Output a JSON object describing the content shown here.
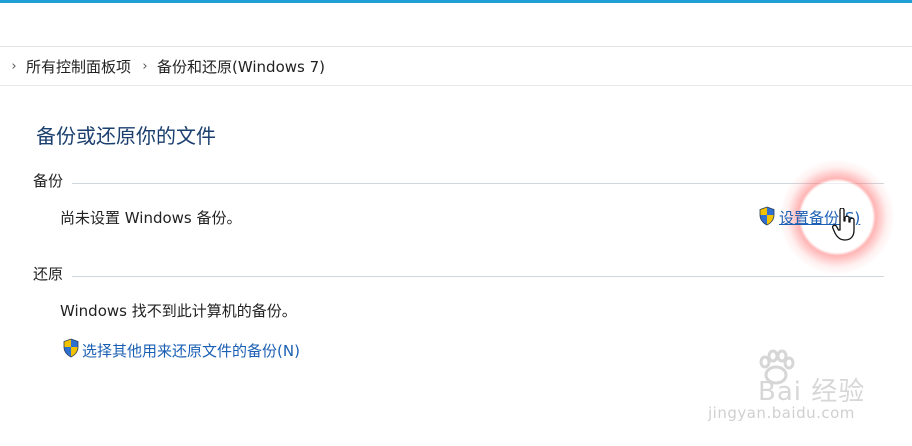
{
  "breadcrumb": {
    "items": [
      "所有控制面板项",
      "备份和还原(Windows 7)"
    ]
  },
  "page_title": "备份或还原你的文件",
  "backup": {
    "section_label": "备份",
    "status_text": "尚未设置 Windows 备份。",
    "setup_link": "设置备份(S)"
  },
  "restore": {
    "section_label": "还原",
    "status_text": "Windows 找不到此计算机的备份。",
    "select_link": "选择其他用来还原文件的备份(N)"
  },
  "watermark": {
    "text": "Bai 经验",
    "url": "jingyan.baidu.com"
  },
  "colors": {
    "title": "#1b3f6e",
    "link": "#1a5fb4",
    "accent_top": "#1f9fd6"
  },
  "icons": {
    "breadcrumb_separator": "chevron-right-icon",
    "uac_shield": "uac-shield-icon",
    "pointer": "hand-cursor-icon"
  }
}
